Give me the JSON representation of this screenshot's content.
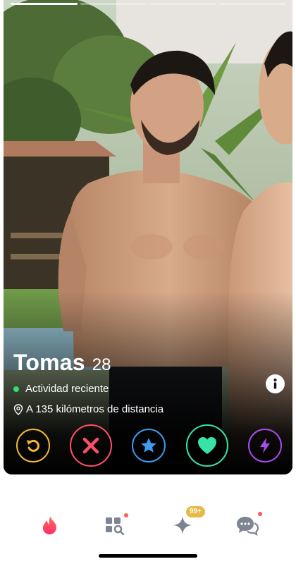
{
  "profile": {
    "name": "Tomas",
    "age": "28",
    "activity": "Actividad reciente",
    "distance": "A 135 kilómetros de distancia"
  },
  "photo": {
    "count": 4,
    "active_index": 0
  },
  "actions": [
    {
      "name": "rewind-button",
      "icon": "rewind-icon",
      "color": "#f2b73a"
    },
    {
      "name": "nope-button",
      "icon": "close-icon",
      "color": "#fd4f68"
    },
    {
      "name": "super-like-button",
      "icon": "star-icon",
      "color": "#3b9cf0"
    },
    {
      "name": "like-button",
      "icon": "heart-icon",
      "color": "#37e3a5"
    },
    {
      "name": "boost-button",
      "icon": "lightning-icon",
      "color": "#a74cf0"
    }
  ],
  "tabbar": {
    "items": [
      "flame-icon",
      "explore-icon",
      "sparkle-icon",
      "chat-icon"
    ],
    "sparkle_badge": "99+",
    "active_color": "#fe4a5d",
    "inactive_color": "#7d8592"
  }
}
